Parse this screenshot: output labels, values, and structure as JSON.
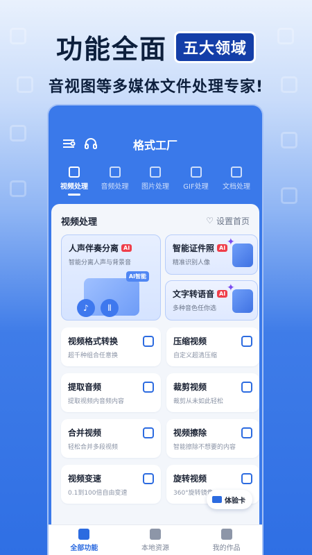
{
  "hero": {
    "title": "功能全面",
    "badge": "五大领域",
    "subtitle": "音视图等多媒体文件处理专家!"
  },
  "app": {
    "title": "格式工厂",
    "icons": [
      "settings-sliders-icon",
      "headset-icon"
    ],
    "category_tabs": [
      {
        "label": "视频处理",
        "active": true
      },
      {
        "label": "音频处理",
        "active": false
      },
      {
        "label": "图片处理",
        "active": false
      },
      {
        "label": "GIF处理",
        "active": false
      },
      {
        "label": "文档处理",
        "active": false
      }
    ]
  },
  "section": {
    "title": "视频处理",
    "set_home": "设置首页"
  },
  "ai_cards": {
    "big": {
      "title": "人声伴奏分离",
      "tag": "AI",
      "desc": "智能分离人声与背景音",
      "illustration_label": "AI智能"
    },
    "id_photo": {
      "title": "智能证件照",
      "tag": "AI",
      "desc": "精准识别人像"
    },
    "tts": {
      "title": "文字转语音",
      "tag": "AI",
      "desc": "多种音色任你选"
    }
  },
  "functions": [
    {
      "title": "视频格式转换",
      "desc": "超千种组合任意换",
      "icon": "video-convert-icon"
    },
    {
      "title": "压缩视频",
      "desc": "自定义超清压缩",
      "icon": "compress-icon"
    },
    {
      "title": "提取音频",
      "desc": "提取视频内音频内容",
      "icon": "music-extract-icon"
    },
    {
      "title": "裁剪视频",
      "desc": "裁剪从未如此轻松",
      "icon": "scissors-icon"
    },
    {
      "title": "合并视频",
      "desc": "轻松合并多段视频",
      "icon": "merge-icon"
    },
    {
      "title": "视频擦除",
      "desc": "智能擦除不想要的内容",
      "icon": "eraser-icon"
    },
    {
      "title": "视频变速",
      "desc": "0.1到100倍自由变速",
      "icon": "speed-icon"
    },
    {
      "title": "旋转视频",
      "desc": "360°旋转镜像",
      "icon": "rotate-icon"
    }
  ],
  "trial_button": "体验卡",
  "bottom_nav": [
    {
      "label": "全部功能",
      "active": true
    },
    {
      "label": "本地资源",
      "active": false
    },
    {
      "label": "我的作品",
      "active": false
    }
  ],
  "colors": {
    "accent": "#2c6be0",
    "hero_badge": "#143ea8",
    "ai_tag": "#ef3e4a"
  }
}
